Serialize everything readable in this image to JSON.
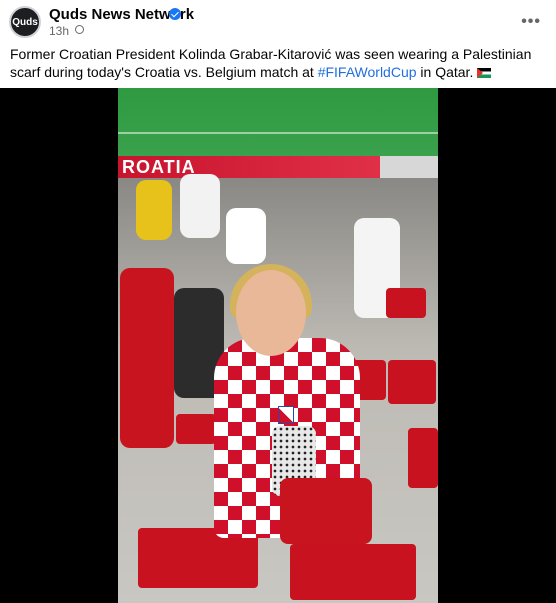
{
  "post": {
    "page_name": "Quds News Network",
    "avatar_text": "Quds",
    "time": "13h",
    "more_label": "•••",
    "caption_text": "Former Croatian President Kolinda Grabar-Kitarović was seen wearing a Palestinian scarf during today's Croatia vs. Belgium match at ",
    "hashtag": "#FIFAWorldCup",
    "caption_suffix": " in Qatar.",
    "flag_icon": "palestine-flag-icon"
  },
  "video": {
    "board_text": "ROATIA"
  },
  "colors": {
    "link": "#216fdb",
    "verified": "#1877f2",
    "croatia_red": "#d0102a"
  }
}
